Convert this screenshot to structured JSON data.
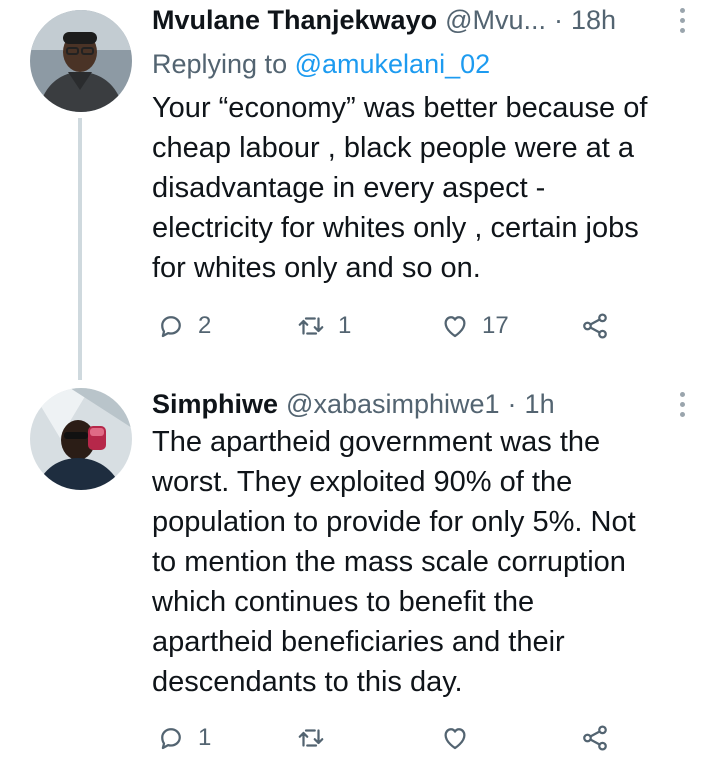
{
  "tweets": [
    {
      "display_name": "Mvulane Thanjekwayo",
      "handle": "@Mvu...",
      "separator": "·",
      "time": "18h",
      "replying_prefix": "Replying to",
      "replying_to": "@amukelani_02",
      "lines": [
        "Your “economy” was better because of",
        "cheap labour , black people were at a",
        "disadvantage in every aspect -",
        "electricity for whites only , certain jobs",
        "for whites only and so on."
      ],
      "reply_count": "2",
      "retweet_count": "1",
      "like_count": "17"
    },
    {
      "display_name": "Simphiwe",
      "handle": "@xabasimphiwe1",
      "separator": "·",
      "time": "1h",
      "lines": [
        "The apartheid government was the",
        "worst. They exploited 90% of the",
        "population to provide for only 5%. Not",
        "to mention the mass scale corruption",
        "which continues to benefit the",
        "apartheid beneficiaries and their",
        "descendants to this day."
      ],
      "reply_count": "1",
      "retweet_count": "",
      "like_count": ""
    }
  ],
  "icons": {
    "reply": "reply-icon",
    "retweet": "retweet-icon",
    "like": "heart-icon",
    "share": "share-icon",
    "more": "more-vertical-icon"
  },
  "colors": {
    "text_primary": "#0f1419",
    "text_secondary": "#536471",
    "link": "#1d9bf0",
    "thread_line": "#cfd9de"
  }
}
